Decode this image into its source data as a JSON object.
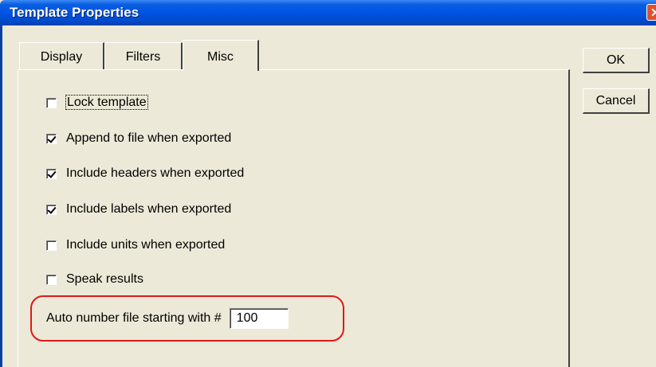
{
  "window": {
    "title": "Template Properties",
    "close_glyph": "✕",
    "colors": {
      "titlebar": "#0054e3",
      "face": "#ece9d8",
      "highlight": "#e01818"
    }
  },
  "tabs": [
    {
      "label": "Display",
      "selected": false
    },
    {
      "label": "Filters",
      "selected": false
    },
    {
      "label": "Misc",
      "selected": true
    }
  ],
  "options": [
    {
      "label": "Lock template",
      "checked": false
    },
    {
      "label": "Append to file when exported",
      "checked": true
    },
    {
      "label": "Include headers when exported",
      "checked": true
    },
    {
      "label": "Include labels when exported",
      "checked": true
    },
    {
      "label": "Include units when exported",
      "checked": false
    },
    {
      "label": "Speak results",
      "checked": false
    }
  ],
  "auto_number": {
    "label": "Auto number file starting with #",
    "value": "100"
  },
  "buttons": {
    "ok": "OK",
    "cancel": "Cancel"
  }
}
